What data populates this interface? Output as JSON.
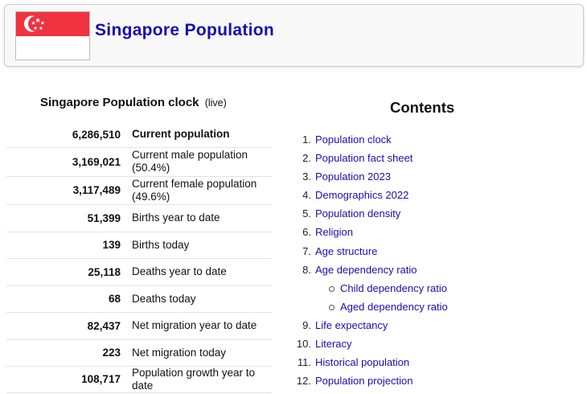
{
  "header": {
    "title": "Singapore Population",
    "flag_colors": {
      "red": "#ef3340",
      "white": "#ffffff"
    }
  },
  "clock": {
    "title": "Singapore Population clock",
    "live": "(live)",
    "rows": [
      {
        "value": "6,286,510",
        "label": "Current population"
      },
      {
        "value": "3,169,021",
        "label": "Current male population (50.4%)"
      },
      {
        "value": "3,117,489",
        "label": "Current female population (49.6%)"
      },
      {
        "value": "51,399",
        "label": "Births year to date"
      },
      {
        "value": "139",
        "label": "Births today"
      },
      {
        "value": "25,118",
        "label": "Deaths year to date"
      },
      {
        "value": "68",
        "label": "Deaths today"
      },
      {
        "value": "82,437",
        "label": "Net migration year to date"
      },
      {
        "value": "223",
        "label": "Net migration today"
      },
      {
        "value": "108,717",
        "label": "Population growth year to date"
      }
    ]
  },
  "contents": {
    "title": "Contents",
    "items": [
      {
        "num": "1.",
        "label": "Population clock"
      },
      {
        "num": "2.",
        "label": "Population fact sheet"
      },
      {
        "num": "3.",
        "label": "Population 2023"
      },
      {
        "num": "4.",
        "label": "Demographics 2022"
      },
      {
        "num": "5.",
        "label": "Population density"
      },
      {
        "num": "6.",
        "label": "Religion"
      },
      {
        "num": "7.",
        "label": "Age structure"
      },
      {
        "num": "8.",
        "label": "Age dependency ratio"
      },
      {
        "num": "",
        "label": "Child dependency ratio",
        "sub": true
      },
      {
        "num": "",
        "label": "Aged dependency ratio",
        "sub": true
      },
      {
        "num": "9.",
        "label": "Life expectancy"
      },
      {
        "num": "10.",
        "label": "Literacy"
      },
      {
        "num": "11.",
        "label": "Historical population"
      },
      {
        "num": "12.",
        "label": "Population projection"
      }
    ]
  }
}
